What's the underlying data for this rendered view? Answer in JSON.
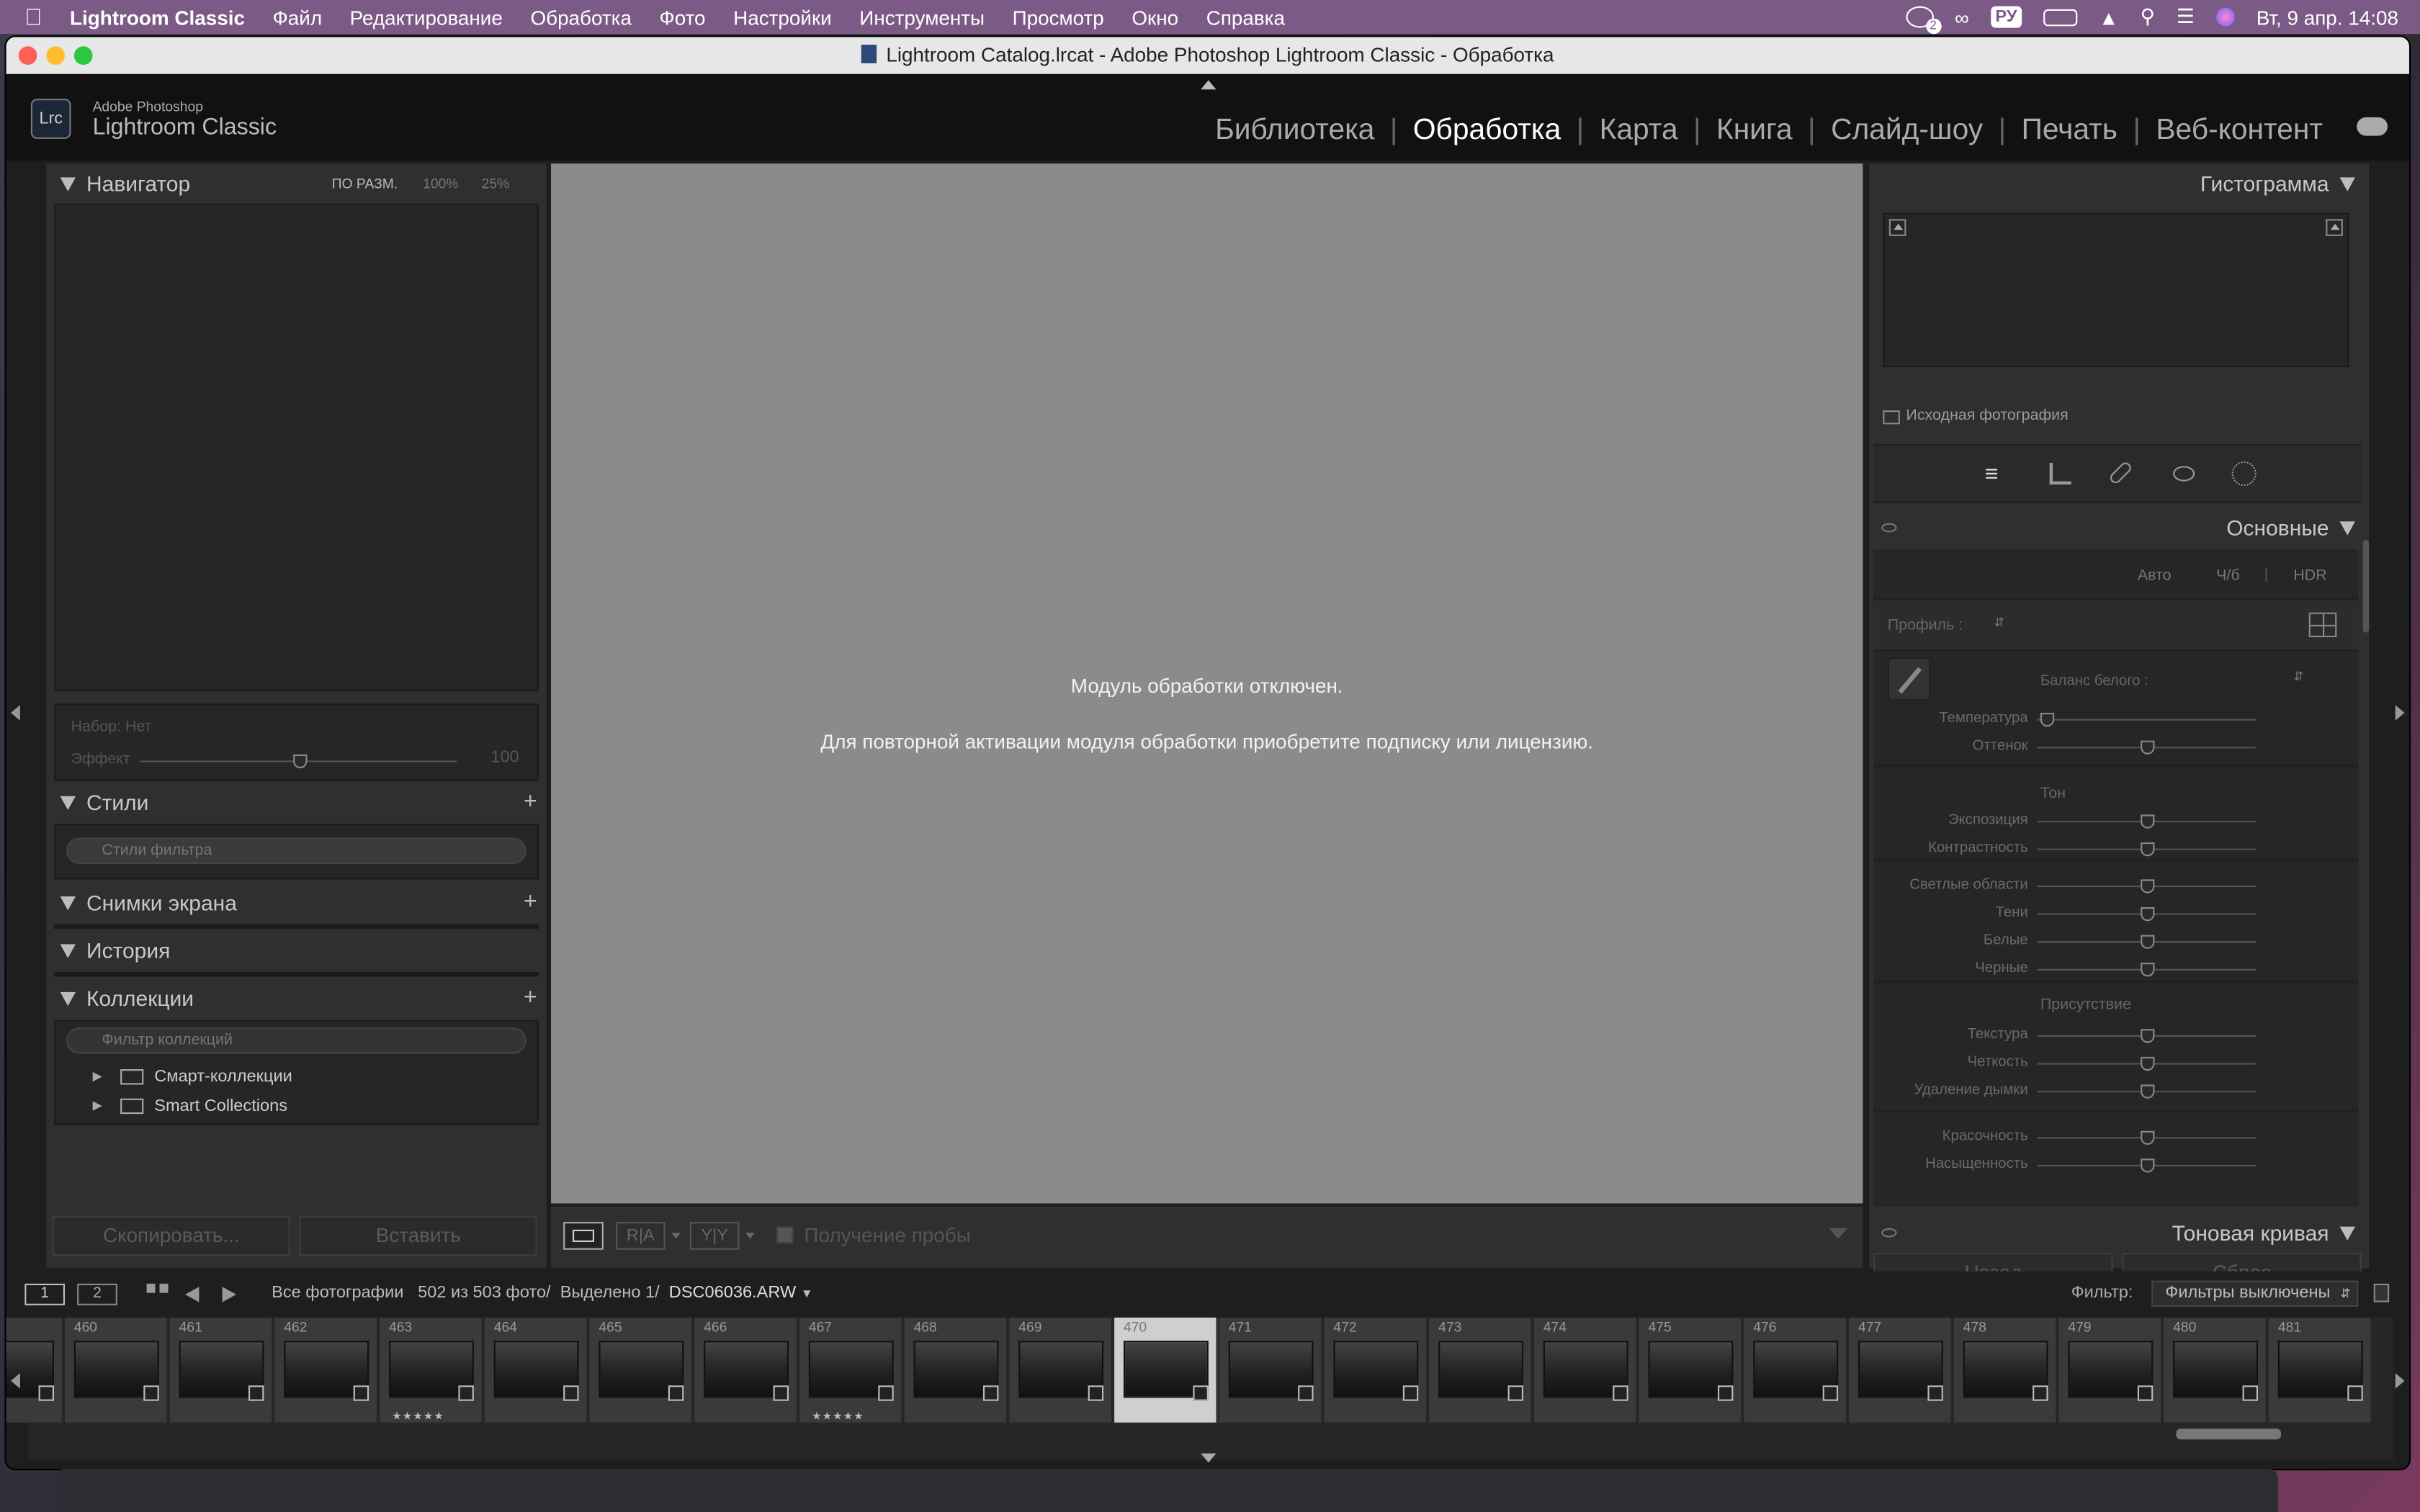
{
  "menubar": {
    "apple": "",
    "app_name": "Lightroom Classic",
    "items": [
      "Файл",
      "Редактирование",
      "Обработка",
      "Фото",
      "Настройки",
      "Инструменты",
      "Просмотр",
      "Окно",
      "Справка"
    ],
    "badge": "2",
    "input_lang": "РУ",
    "datetime": "Вт, 9 апр.  14:08"
  },
  "window": {
    "title": "Lightroom Catalog.lrcat - Adobe Photoshop Lightroom Classic - Обработка"
  },
  "identity": {
    "logo": "Lrc",
    "brand_line1": "Adobe Photoshop",
    "brand_line2": "Lightroom Classic",
    "modules": [
      {
        "label": "Библиотека",
        "active": false
      },
      {
        "label": "Обработка",
        "active": true
      },
      {
        "label": "Карта",
        "active": false
      },
      {
        "label": "Книга",
        "active": false
      },
      {
        "label": "Слайд-шоу",
        "active": false
      },
      {
        "label": "Печать",
        "active": false
      },
      {
        "label": "Веб-контент",
        "active": false
      }
    ]
  },
  "left": {
    "navigator": {
      "title": "Навигатор",
      "fit": "ПО РАЗМ.",
      "z1": "100%",
      "z2": "25%"
    },
    "preset": {
      "label": "Набор: Нет",
      "effect": "Эффект",
      "value": "100",
      "effect_level": 0.5
    },
    "styles": {
      "title": "Стили",
      "placeholder": "Стили фильтра"
    },
    "snapshots": {
      "title": "Снимки экрана"
    },
    "history": {
      "title": "История"
    },
    "collections": {
      "title": "Коллекции",
      "placeholder": "Фильтр коллекций",
      "items": [
        "Смарт-коллекции",
        "Smart Collections"
      ]
    },
    "copy_btn": "Скопировать...",
    "paste_btn": "Вставить"
  },
  "center": {
    "line1": "Модуль обработки отключен.",
    "line2": "Для повторной активации модуля обработки приобретите подписку или лицензию.",
    "toolbar": {
      "ra": "R|A",
      "yy": "Y|Y",
      "sample": "Получение пробы"
    }
  },
  "right": {
    "histogram": {
      "title": "Гистограмма",
      "original": "Исходная фотография"
    },
    "basic": {
      "title": "Основные",
      "auto": "Авто",
      "bw": "Ч/б",
      "hdr": "HDR",
      "profile": "Профиль :",
      "wb": "Баланс белого :",
      "rows1": [
        {
          "label": "Температура",
          "pos": 0.04
        },
        {
          "label": "Оттенок",
          "pos": 0.5
        }
      ],
      "tone_title": "Тон",
      "rows2": [
        {
          "label": "Экспозиция",
          "pos": 0.5
        },
        {
          "label": "Контрастность",
          "pos": 0.5
        }
      ],
      "rows3": [
        {
          "label": "Светлые области",
          "pos": 0.5
        },
        {
          "label": "Тени",
          "pos": 0.5
        },
        {
          "label": "Белые",
          "pos": 0.5
        },
        {
          "label": "Черные",
          "pos": 0.5
        }
      ],
      "presence_title": "Присутствие",
      "rows4": [
        {
          "label": "Текстура",
          "pos": 0.5
        },
        {
          "label": "Четкость",
          "pos": 0.5
        },
        {
          "label": "Удаление дымки",
          "pos": 0.5
        }
      ],
      "rows5": [
        {
          "label": "Красочность",
          "pos": 0.5
        },
        {
          "label": "Насыщенность",
          "pos": 0.5
        }
      ]
    },
    "tone_curve": {
      "title": "Тоновая кривая"
    },
    "back_btn": "Назад",
    "reset_btn": "Сброс"
  },
  "filmbar": {
    "screen1": "1",
    "screen2": "2",
    "source": "Все фотографии",
    "count": "502 из 503 фото/",
    "selected": "Выделено 1/",
    "filename": "DSC06036.ARW",
    "filter_label": "Фильтр:",
    "filter_value": "Фильтры выключены"
  },
  "filmstrip": [
    {
      "num": "",
      "stars": ""
    },
    {
      "num": "460",
      "stars": ""
    },
    {
      "num": "461",
      "stars": ""
    },
    {
      "num": "462",
      "stars": ""
    },
    {
      "num": "463",
      "stars": "★★★★★"
    },
    {
      "num": "464",
      "stars": ""
    },
    {
      "num": "465",
      "stars": ""
    },
    {
      "num": "466",
      "stars": ""
    },
    {
      "num": "467",
      "stars": "★★★★★"
    },
    {
      "num": "468",
      "stars": ""
    },
    {
      "num": "469",
      "stars": ""
    },
    {
      "num": "470",
      "stars": "",
      "selected": true
    },
    {
      "num": "471",
      "stars": ""
    },
    {
      "num": "472",
      "stars": ""
    },
    {
      "num": "473",
      "stars": ""
    },
    {
      "num": "474",
      "stars": ""
    },
    {
      "num": "475",
      "stars": ""
    },
    {
      "num": "476",
      "stars": ""
    },
    {
      "num": "477",
      "stars": ""
    },
    {
      "num": "478",
      "stars": ""
    },
    {
      "num": "479",
      "stars": ""
    },
    {
      "num": "480",
      "stars": ""
    },
    {
      "num": "481",
      "stars": ""
    }
  ]
}
